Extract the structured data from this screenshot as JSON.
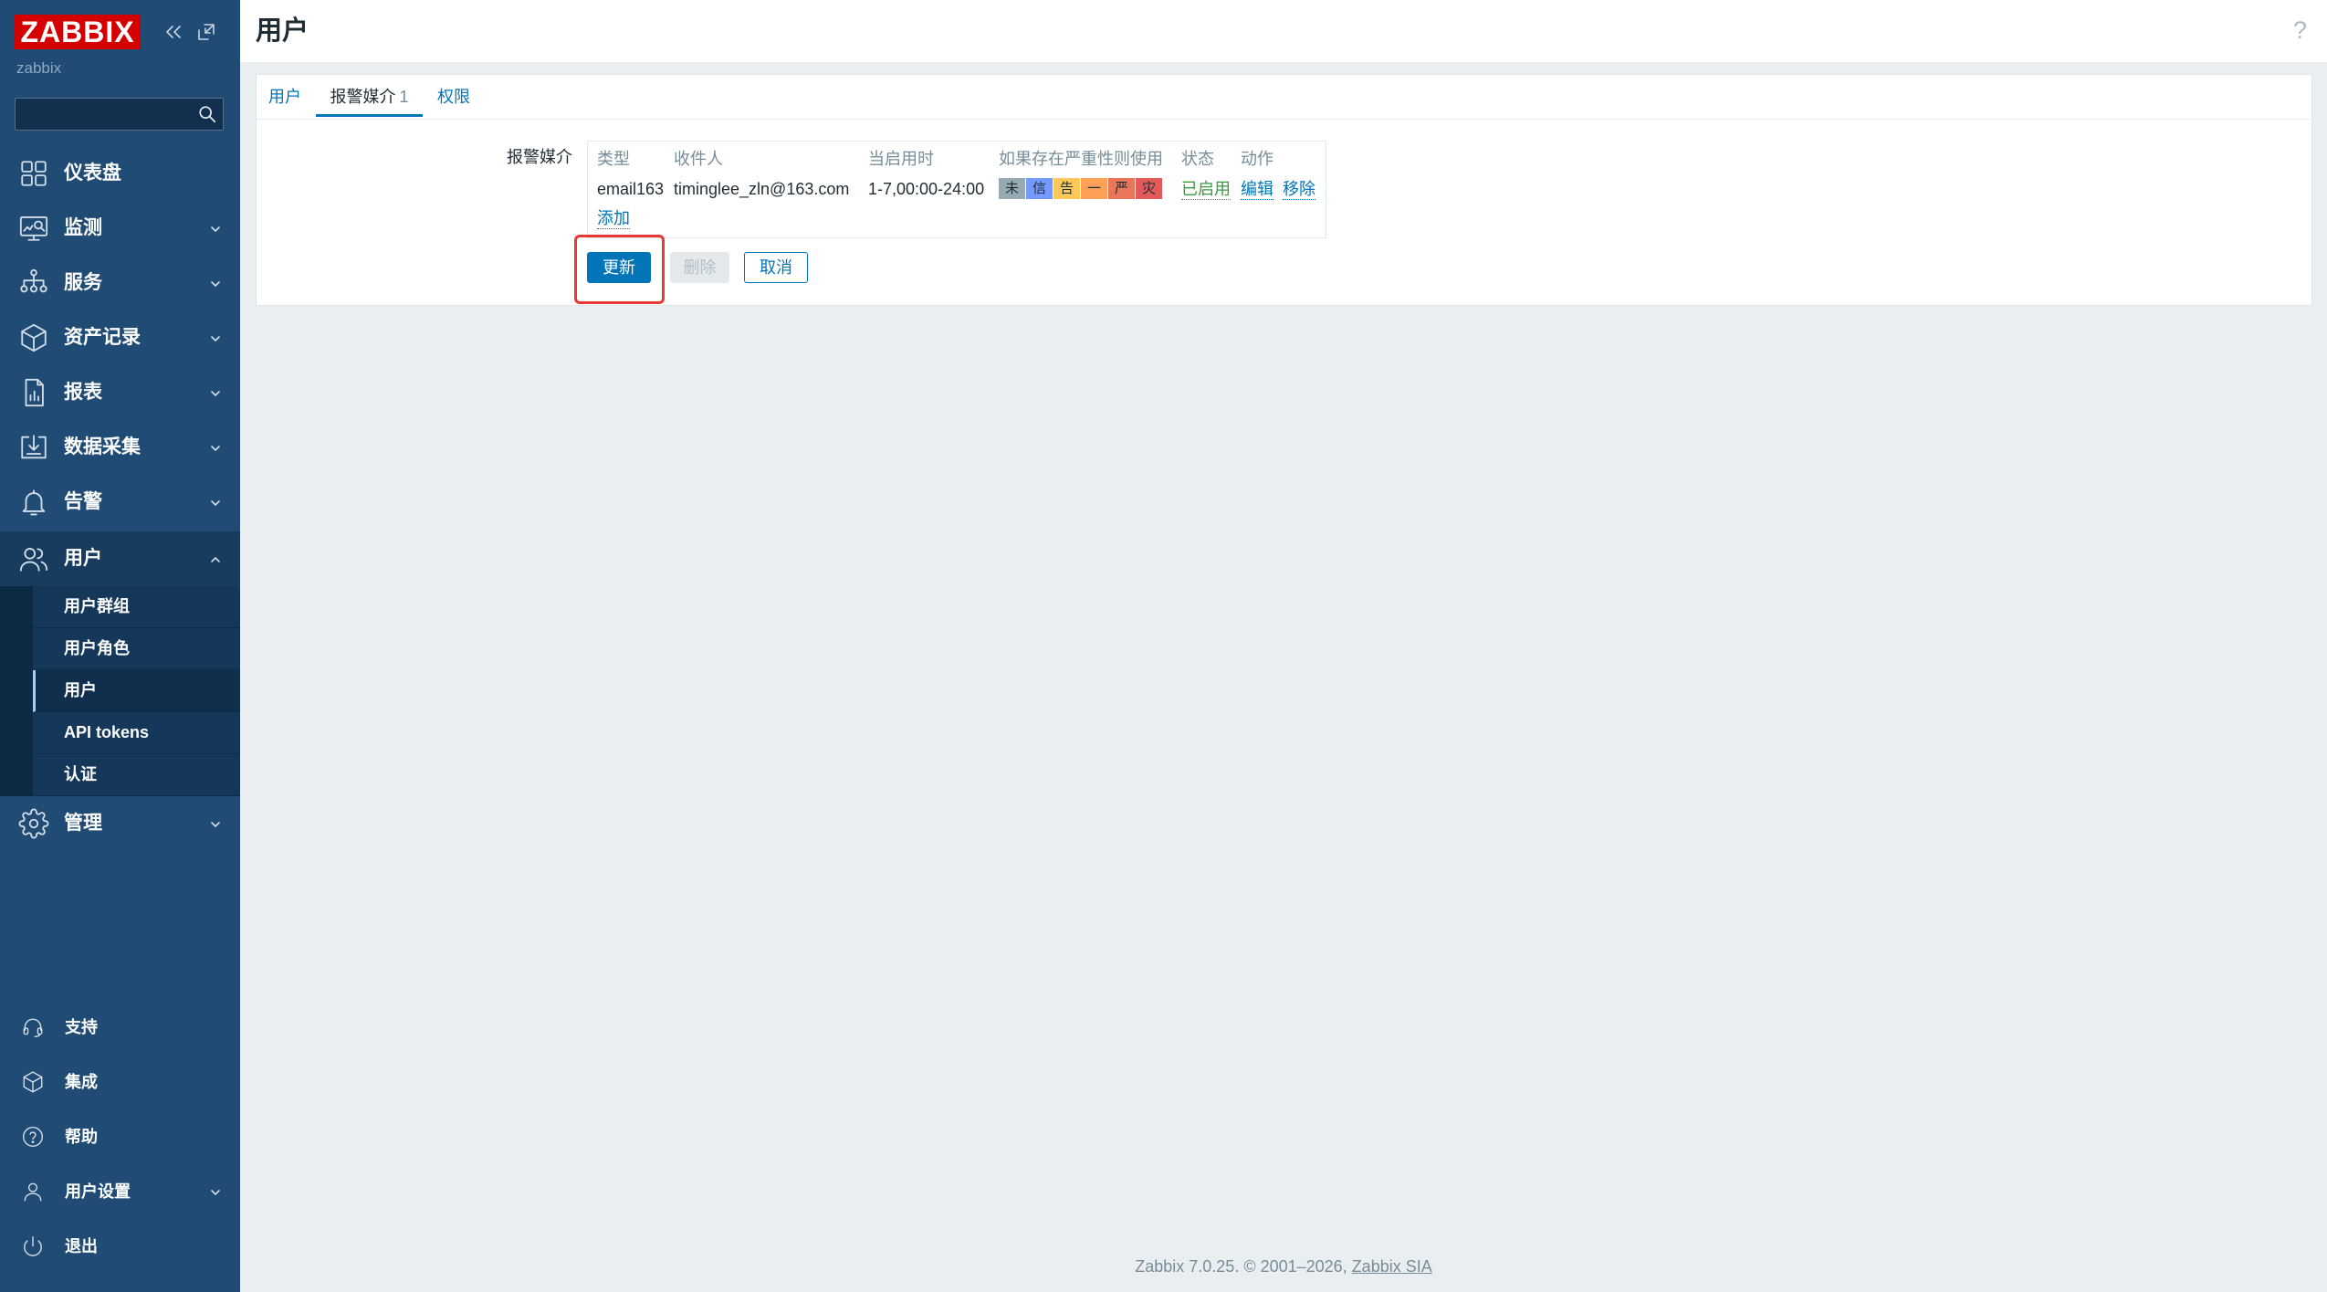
{
  "brand": {
    "logo_text": "ZABBIX",
    "server_name": "zabbix",
    "color": "#d40000"
  },
  "search": {
    "value": "",
    "placeholder": ""
  },
  "sidebar": {
    "menu": [
      {
        "label": "仪表盘",
        "icon": "dashboard-icon"
      },
      {
        "label": "监测",
        "icon": "monitoring-icon"
      },
      {
        "label": "服务",
        "icon": "services-icon"
      },
      {
        "label": "资产记录",
        "icon": "inventory-icon"
      },
      {
        "label": "报表",
        "icon": "reports-icon"
      },
      {
        "label": "数据采集",
        "icon": "data-collection-icon"
      },
      {
        "label": "告警",
        "icon": "alerts-icon"
      },
      {
        "label": "用户",
        "icon": "users-icon",
        "expanded": true
      },
      {
        "label": "管理",
        "icon": "administration-icon"
      }
    ],
    "users_submenu": [
      {
        "label": "用户群组"
      },
      {
        "label": "用户角色"
      },
      {
        "label": "用户",
        "active": true
      },
      {
        "label": "API tokens"
      },
      {
        "label": "认证"
      }
    ],
    "bottom": [
      {
        "label": "支持",
        "icon": "support-icon"
      },
      {
        "label": "集成",
        "icon": "integrations-icon"
      },
      {
        "label": "帮助",
        "icon": "help-icon"
      },
      {
        "label": "用户设置",
        "icon": "user-settings-icon"
      },
      {
        "label": "退出",
        "icon": "sign-out-icon"
      }
    ]
  },
  "header": {
    "title": "用户",
    "help_glyph": "?"
  },
  "tabs": [
    {
      "label": "用户"
    },
    {
      "label": "报警媒介",
      "count": "1",
      "active": true
    },
    {
      "label": "权限"
    }
  ],
  "form": {
    "media_label": "报警媒介",
    "media_table": {
      "headers": [
        "类型",
        "收件人",
        "当启用时",
        "如果存在严重性则使用",
        "状态",
        "动作"
      ],
      "rows": [
        {
          "type": "email163",
          "send_to": "timinglee_zln@163.com",
          "when_active": "1-7,00:00-24:00",
          "severities": [
            {
              "label": "未",
              "color": "#97aab3"
            },
            {
              "label": "信",
              "color": "#7499ff"
            },
            {
              "label": "告",
              "color": "#ffc859"
            },
            {
              "label": "一",
              "color": "#ffa059"
            },
            {
              "label": "严",
              "color": "#e97659"
            },
            {
              "label": "灾",
              "color": "#e45959"
            }
          ],
          "status": "已启用",
          "actions": [
            "编辑",
            "移除"
          ]
        }
      ],
      "add_link": "添加"
    },
    "buttons": {
      "update": "更新",
      "delete": "删除",
      "cancel": "取消"
    }
  },
  "footer": {
    "text": "Zabbix 7.0.25. © 2001–2026, ",
    "link": "Zabbix SIA"
  },
  "colors": {
    "accent": "#0275b8",
    "sidebar": "#1f4b74",
    "status_enabled": "#3a9a3f",
    "highlight": "#e53935"
  }
}
